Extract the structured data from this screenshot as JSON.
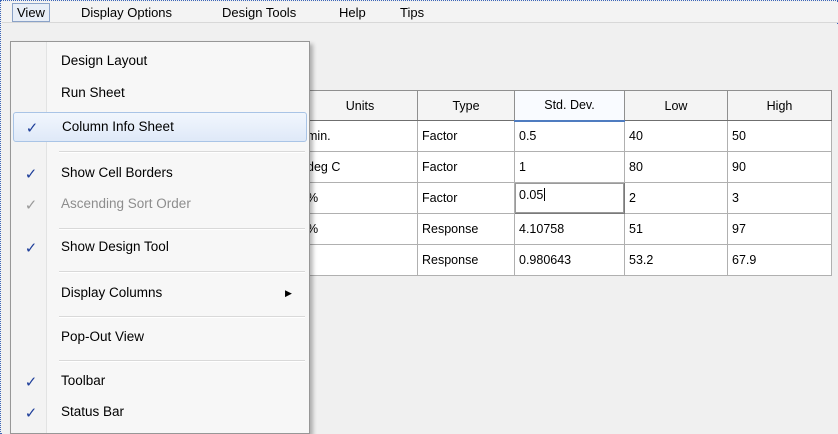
{
  "menubar": {
    "items": [
      "View",
      "Display Options",
      "Design Tools",
      "Help",
      "Tips"
    ]
  },
  "view_menu": {
    "design_layout": "Design Layout",
    "run_sheet": "Run Sheet",
    "column_info_sheet": "Column Info Sheet",
    "show_cell_borders": "Show Cell Borders",
    "ascending_sort_order": "Ascending Sort Order",
    "show_design_tool": "Show Design Tool",
    "display_columns": "Display Columns",
    "pop_out_view": "Pop-Out View",
    "toolbar": "Toolbar",
    "status_bar": "Status Bar",
    "check_glyph": "✓",
    "submenu_arrow": "▶"
  },
  "sheet": {
    "headers": [
      "Units",
      "Type",
      "Std. Dev.",
      "Low",
      "High"
    ],
    "rows": [
      [
        "min.",
        "Factor",
        "0.5",
        "40",
        "50"
      ],
      [
        "deg C",
        "Factor",
        "1",
        "80",
        "90"
      ],
      [
        "%",
        "Factor",
        "0.05",
        "2",
        "3"
      ],
      [
        "%",
        "Response",
        "4.10758",
        "51",
        "97"
      ],
      [
        "",
        "Response",
        "0.980643",
        "53.2",
        "67.9"
      ]
    ]
  },
  "colors": {
    "check": "#1f3f9a",
    "highlight_border": "#a9c4e6",
    "sorted_header_underline": "#4f7cc0"
  }
}
